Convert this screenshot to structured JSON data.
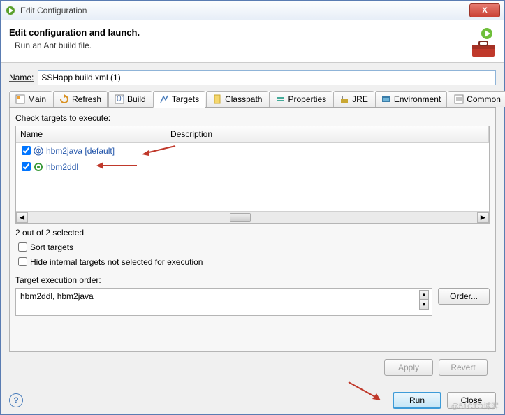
{
  "window": {
    "title": "Edit Configuration",
    "close": "X"
  },
  "header": {
    "title": "Edit configuration and launch.",
    "subtitle": "Run an Ant build file."
  },
  "name": {
    "label": "Name:",
    "value": "SSHapp build.xml (1)"
  },
  "tabs": {
    "main": "Main",
    "refresh": "Refresh",
    "build": "Build",
    "targets": "Targets",
    "classpath": "Classpath",
    "properties": "Properties",
    "jre": "JRE",
    "environment": "Environment",
    "common": "Common"
  },
  "targets": {
    "label": "Check targets to execute:",
    "columns": {
      "name": "Name",
      "desc": "Description"
    },
    "rows": [
      {
        "checked": true,
        "icon": "bullseye",
        "name": "hbm2java [default]"
      },
      {
        "checked": true,
        "icon": "target",
        "name": "hbm2ddl"
      }
    ],
    "selected_text": "2 out of 2 selected",
    "sort": {
      "label": "Sort targets",
      "checked": false
    },
    "hide": {
      "label": "Hide internal targets not selected for execution",
      "checked": false
    },
    "exec_label": "Target execution order:",
    "exec_value": "hbm2ddl, hbm2java",
    "order_btn": "Order..."
  },
  "buttons": {
    "apply": "Apply",
    "revert": "Revert",
    "run": "Run",
    "close": "Close"
  },
  "watermark": "@51CTO博客"
}
